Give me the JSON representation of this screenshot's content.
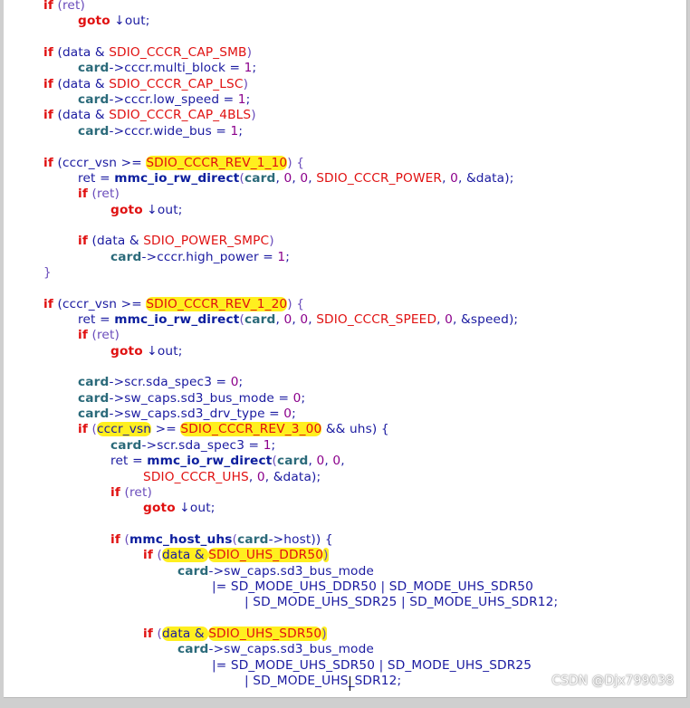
{
  "watermark": "CSDN @Djx799038",
  "colors": {
    "keyword": "#e01010",
    "text": "#1a1aa0",
    "number": "#8b008b",
    "paren": "#6a4cbb",
    "operator": "#7a2c7a",
    "var": "#2b6a7a",
    "bold_func": "#0c1e9e",
    "highlight": "#ffef1f"
  },
  "code_lines": [
    {
      "indent": 0,
      "tokens": [
        {
          "t": "if",
          "c": "kw",
          "b": true
        },
        {
          "t": " (ret)",
          "c": "paren"
        }
      ]
    },
    {
      "indent": 1,
      "tokens": [
        {
          "t": "goto",
          "c": "kw",
          "b": true
        },
        {
          "t": " ↓out;",
          "c": "text"
        }
      ]
    },
    {
      "indent": 0,
      "tokens": []
    },
    {
      "indent": 0,
      "tokens": [
        {
          "t": "if",
          "c": "kw",
          "b": true
        },
        {
          "t": " (data & ",
          "c": "text"
        },
        {
          "t": "SDIO_CCCR_CAP_SMB",
          "c": "kw"
        },
        {
          "t": ")",
          "c": "paren"
        }
      ]
    },
    {
      "indent": 1,
      "tokens": [
        {
          "t": "card",
          "c": "var",
          "b": true
        },
        {
          "t": "->cccr.multi_block = ",
          "c": "text"
        },
        {
          "t": "1",
          "c": "number"
        },
        {
          "t": ";",
          "c": "text"
        }
      ]
    },
    {
      "indent": 0,
      "tokens": [
        {
          "t": "if",
          "c": "kw",
          "b": true
        },
        {
          "t": " (data & ",
          "c": "text"
        },
        {
          "t": "SDIO_CCCR_CAP_LSC",
          "c": "kw"
        },
        {
          "t": ")",
          "c": "paren"
        }
      ]
    },
    {
      "indent": 1,
      "tokens": [
        {
          "t": "card",
          "c": "var",
          "b": true
        },
        {
          "t": "->cccr.low_speed = ",
          "c": "text"
        },
        {
          "t": "1",
          "c": "number"
        },
        {
          "t": ";",
          "c": "text"
        }
      ]
    },
    {
      "indent": 0,
      "tokens": [
        {
          "t": "if",
          "c": "kw",
          "b": true
        },
        {
          "t": " (data & ",
          "c": "text"
        },
        {
          "t": "SDIO_CCCR_CAP_4BLS",
          "c": "kw"
        },
        {
          "t": ")",
          "c": "paren"
        }
      ]
    },
    {
      "indent": 1,
      "tokens": [
        {
          "t": "card",
          "c": "var",
          "b": true
        },
        {
          "t": "->cccr.wide_bus = ",
          "c": "text"
        },
        {
          "t": "1",
          "c": "number"
        },
        {
          "t": ";",
          "c": "text"
        }
      ]
    },
    {
      "indent": 0,
      "tokens": []
    },
    {
      "indent": 0,
      "tokens": [
        {
          "t": "if",
          "c": "kw",
          "b": true
        },
        {
          "t": " (cccr_vsn >= ",
          "c": "text"
        },
        {
          "t": "SDIO_CCCR_REV_1_10",
          "c": "kw",
          "h": true
        },
        {
          "t": ") {",
          "c": "paren"
        }
      ]
    },
    {
      "indent": 1,
      "tokens": [
        {
          "t": "ret = ",
          "c": "text"
        },
        {
          "t": "mmc_io_rw_direct",
          "c": "bold_func",
          "b": true
        },
        {
          "t": "(",
          "c": "paren"
        },
        {
          "t": "card",
          "c": "var",
          "b": true
        },
        {
          "t": ", ",
          "c": "text"
        },
        {
          "t": "0",
          "c": "number"
        },
        {
          "t": ", ",
          "c": "text"
        },
        {
          "t": "0",
          "c": "number"
        },
        {
          "t": ", ",
          "c": "text"
        },
        {
          "t": "SDIO_CCCR_POWER",
          "c": "kw"
        },
        {
          "t": ", ",
          "c": "text"
        },
        {
          "t": "0",
          "c": "number"
        },
        {
          "t": ", &data);",
          "c": "text"
        }
      ]
    },
    {
      "indent": 1,
      "tokens": [
        {
          "t": "if",
          "c": "kw",
          "b": true
        },
        {
          "t": " (ret)",
          "c": "paren"
        }
      ]
    },
    {
      "indent": 2,
      "tokens": [
        {
          "t": "goto",
          "c": "kw",
          "b": true
        },
        {
          "t": " ↓out;",
          "c": "text"
        }
      ]
    },
    {
      "indent": 0,
      "tokens": []
    },
    {
      "indent": 1,
      "tokens": [
        {
          "t": "if",
          "c": "kw",
          "b": true
        },
        {
          "t": " (data & ",
          "c": "text"
        },
        {
          "t": "SDIO_POWER_SMPC",
          "c": "kw"
        },
        {
          "t": ")",
          "c": "paren"
        }
      ]
    },
    {
      "indent": 2,
      "tokens": [
        {
          "t": "card",
          "c": "var",
          "b": true
        },
        {
          "t": "->cccr.high_power = ",
          "c": "text"
        },
        {
          "t": "1",
          "c": "number"
        },
        {
          "t": ";",
          "c": "text"
        }
      ]
    },
    {
      "indent": 0,
      "tokens": [
        {
          "t": "}",
          "c": "paren"
        }
      ]
    },
    {
      "indent": 0,
      "tokens": []
    },
    {
      "indent": 0,
      "tokens": [
        {
          "t": "if",
          "c": "kw",
          "b": true
        },
        {
          "t": " (cccr_vsn >= ",
          "c": "text"
        },
        {
          "t": "SDIO_CCCR_REV_1_20",
          "c": "kw",
          "h": true
        },
        {
          "t": ") {",
          "c": "paren"
        }
      ]
    },
    {
      "indent": 1,
      "tokens": [
        {
          "t": "ret = ",
          "c": "text"
        },
        {
          "t": "mmc_io_rw_direct",
          "c": "bold_func",
          "b": true
        },
        {
          "t": "(",
          "c": "paren"
        },
        {
          "t": "card",
          "c": "var",
          "b": true
        },
        {
          "t": ", ",
          "c": "text"
        },
        {
          "t": "0",
          "c": "number"
        },
        {
          "t": ", ",
          "c": "text"
        },
        {
          "t": "0",
          "c": "number"
        },
        {
          "t": ", ",
          "c": "text"
        },
        {
          "t": "SDIO_CCCR_SPEED",
          "c": "kw"
        },
        {
          "t": ", ",
          "c": "text"
        },
        {
          "t": "0",
          "c": "number"
        },
        {
          "t": ", &speed);",
          "c": "text"
        }
      ]
    },
    {
      "indent": 1,
      "tokens": [
        {
          "t": "if",
          "c": "kw",
          "b": true
        },
        {
          "t": " (ret)",
          "c": "paren"
        }
      ]
    },
    {
      "indent": 2,
      "tokens": [
        {
          "t": "goto",
          "c": "kw",
          "b": true
        },
        {
          "t": " ↓out;",
          "c": "text"
        }
      ]
    },
    {
      "indent": 0,
      "tokens": []
    },
    {
      "indent": 1,
      "tokens": [
        {
          "t": "card",
          "c": "var",
          "b": true
        },
        {
          "t": "->scr.sda_spec3 = ",
          "c": "text"
        },
        {
          "t": "0",
          "c": "number"
        },
        {
          "t": ";",
          "c": "text"
        }
      ]
    },
    {
      "indent": 1,
      "tokens": [
        {
          "t": "card",
          "c": "var",
          "b": true
        },
        {
          "t": "->sw_caps.sd3_bus_mode = ",
          "c": "text"
        },
        {
          "t": "0",
          "c": "number"
        },
        {
          "t": ";",
          "c": "text"
        }
      ]
    },
    {
      "indent": 1,
      "tokens": [
        {
          "t": "card",
          "c": "var",
          "b": true
        },
        {
          "t": "->sw_caps.sd3_drv_type = ",
          "c": "text"
        },
        {
          "t": "0",
          "c": "number"
        },
        {
          "t": ";",
          "c": "text"
        }
      ]
    },
    {
      "indent": 1,
      "tokens": [
        {
          "t": "if",
          "c": "kw",
          "b": true
        },
        {
          "t": " (",
          "c": "paren"
        },
        {
          "t": "cccr_vsn",
          "c": "text",
          "h": true
        },
        {
          "t": " >= ",
          "c": "text"
        },
        {
          "t": "SDIO_CCCR_REV_3_00",
          "c": "kw",
          "h": true
        },
        {
          "t": " && uhs) {",
          "c": "text"
        }
      ]
    },
    {
      "indent": 2,
      "tokens": [
        {
          "t": "card",
          "c": "var",
          "b": true
        },
        {
          "t": "->scr.sda_spec3 = ",
          "c": "text"
        },
        {
          "t": "1",
          "c": "number"
        },
        {
          "t": ";",
          "c": "text"
        }
      ]
    },
    {
      "indent": 2,
      "tokens": [
        {
          "t": "ret = ",
          "c": "text"
        },
        {
          "t": "mmc_io_rw_direct",
          "c": "bold_func",
          "b": true
        },
        {
          "t": "(",
          "c": "paren"
        },
        {
          "t": "card",
          "c": "var",
          "b": true
        },
        {
          "t": ", ",
          "c": "text"
        },
        {
          "t": "0",
          "c": "number"
        },
        {
          "t": ", ",
          "c": "text"
        },
        {
          "t": "0",
          "c": "number"
        },
        {
          "t": ",",
          "c": "text"
        }
      ]
    },
    {
      "indent": 3,
      "tokens": [
        {
          "t": "SDIO_CCCR_UHS",
          "c": "kw"
        },
        {
          "t": ", ",
          "c": "text"
        },
        {
          "t": "0",
          "c": "number"
        },
        {
          "t": ", &data);",
          "c": "text"
        }
      ]
    },
    {
      "indent": 2,
      "tokens": [
        {
          "t": "if",
          "c": "kw",
          "b": true
        },
        {
          "t": " (ret)",
          "c": "paren"
        }
      ]
    },
    {
      "indent": 3,
      "tokens": [
        {
          "t": "goto",
          "c": "kw",
          "b": true
        },
        {
          "t": " ↓out;",
          "c": "text"
        }
      ]
    },
    {
      "indent": 0,
      "tokens": []
    },
    {
      "indent": 2,
      "tokens": [
        {
          "t": "if",
          "c": "kw",
          "b": true
        },
        {
          "t": " (",
          "c": "paren"
        },
        {
          "t": "mmc_host_uhs",
          "c": "bold_func",
          "b": true
        },
        {
          "t": "(",
          "c": "paren"
        },
        {
          "t": "card",
          "c": "var",
          "b": true
        },
        {
          "t": "->host)) {",
          "c": "text"
        }
      ]
    },
    {
      "indent": 3,
      "tokens": [
        {
          "t": "if",
          "c": "kw",
          "b": true
        },
        {
          "t": " (",
          "c": "paren"
        },
        {
          "t": "data & ",
          "c": "text",
          "h": true
        },
        {
          "t": "SDIO_UHS_DDR50",
          "c": "kw",
          "h": true
        },
        {
          "t": ")",
          "c": "paren",
          "h": true
        }
      ]
    },
    {
      "indent": 4,
      "tokens": [
        {
          "t": "card",
          "c": "var",
          "b": true
        },
        {
          "t": "->sw_caps.sd3_bus_mode",
          "c": "text"
        }
      ]
    },
    {
      "indent": 5,
      "tokens": [
        {
          "t": "|= SD_MODE_UHS_DDR50 | SD_MODE_UHS_SDR50",
          "c": "text"
        }
      ]
    },
    {
      "indent": 6,
      "tokens": [
        {
          "t": "| SD_MODE_UHS_SDR25 | SD_MODE_UHS_SDR12;",
          "c": "text"
        }
      ]
    },
    {
      "indent": 0,
      "tokens": []
    },
    {
      "indent": 3,
      "tokens": [
        {
          "t": "if",
          "c": "kw",
          "b": true
        },
        {
          "t": " (",
          "c": "paren"
        },
        {
          "t": "data & ",
          "c": "text",
          "h": true
        },
        {
          "t": "SDIO_UHS_SDR50",
          "c": "kw",
          "h": true
        },
        {
          "t": ")",
          "c": "paren",
          "h": true
        }
      ]
    },
    {
      "indent": 4,
      "tokens": [
        {
          "t": "card",
          "c": "var",
          "b": true
        },
        {
          "t": "->sw_caps.sd3_bus_mode",
          "c": "text"
        }
      ]
    },
    {
      "indent": 5,
      "tokens": [
        {
          "t": "|= SD_MODE_UHS_SDR50 | SD_MODE_UHS_SDR25",
          "c": "text"
        }
      ]
    },
    {
      "indent": 6,
      "tokens": [
        {
          "t": "| SD_MODE_UHS_SDR12;",
          "c": "text"
        }
      ]
    }
  ]
}
